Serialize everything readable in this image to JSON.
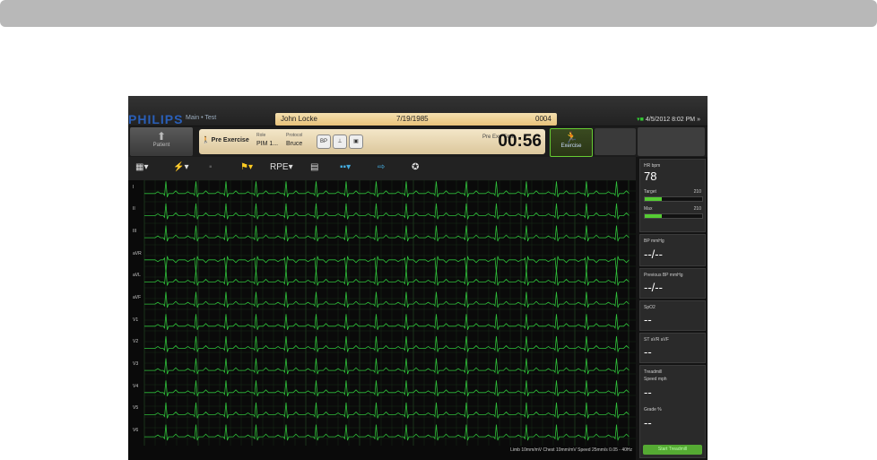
{
  "brand": {
    "logo": "PHILIPS",
    "sub": "Main • Test"
  },
  "patient": {
    "name": "John Locke",
    "dob": "7/19/1985",
    "id": "0004"
  },
  "status": {
    "datetime": "4/5/2012 8:02 PM",
    "arrow": "»"
  },
  "controls": {
    "patient_label": "Patient",
    "pre_exercise": "Pre Exercise",
    "role_label": "Role",
    "role_value": "PIM 1...",
    "protocol_label": "Protocol",
    "protocol_value": "Bruce",
    "bp_label": "BP",
    "pre_ex_time_label": "Pre Exe Time",
    "timer": "00:56",
    "exercise_label": "Exercise"
  },
  "toolbar": {
    "rpe_label": "RPE"
  },
  "leads": [
    "I",
    "II",
    "III",
    "aVR",
    "aVL",
    "aVF",
    "V1",
    "V2",
    "V3",
    "V4",
    "V5",
    "V6"
  ],
  "footer": "Limb 10mm/mV Chest 10mm/mV Speed 25mm/s 0.05 - 40Hz",
  "panel": {
    "hr_label": "HR bpm",
    "hr_value": "78",
    "target_label": "Target",
    "target_value": "210",
    "target_pct": 0.3,
    "max_label": "Max",
    "max_value": "210",
    "max_pct": 0.3,
    "bp_label": "BP mmHg",
    "bp_value": "--/--",
    "prev_bp_label": "Previous BP mmHg",
    "prev_bp_value": "--/--",
    "spo2_label": "SpO2",
    "spo2_value": "--",
    "st_label": "ST aVR aVF",
    "st_value": "--",
    "treadmill_label": "Treadmill",
    "speed_label": "Speed mph",
    "speed_value": "--",
    "grade_label": "Grade %",
    "grade_value": "--",
    "start_treadmill": "Start Treadmill"
  },
  "colors": {
    "ecg_trace": "#2fbf3a",
    "grid": "#1f3d1f"
  }
}
